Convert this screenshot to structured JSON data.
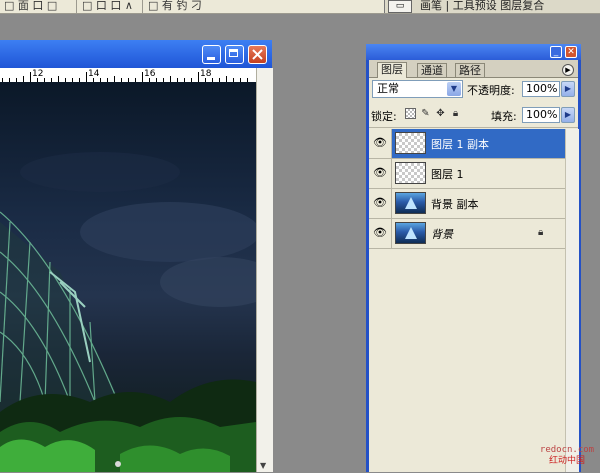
{
  "optionsbar": {
    "fragments": [
      "□ 面 口 □",
      "□ 口 口 ∧",
      "□ 有 钓 刁"
    ],
    "tray_text": "画笔 | 工具预设 图层复合"
  },
  "document": {
    "ruler_labels": [
      "12",
      "14",
      "16",
      "18"
    ]
  },
  "layers_panel": {
    "tabs": [
      {
        "label": "图层",
        "active": true
      },
      {
        "label": "通道",
        "active": false
      },
      {
        "label": "路径",
        "active": false
      }
    ],
    "blend_mode": "正常",
    "opacity_label": "不透明度:",
    "opacity_value": "100%",
    "lock_label": "锁定:",
    "fill_label": "填充:",
    "fill_value": "100%",
    "layers": [
      {
        "name": "图层 1 副本",
        "thumb": "transparent",
        "selected": true,
        "locked": false,
        "visible": true
      },
      {
        "name": "图层 1",
        "thumb": "transparent",
        "selected": false,
        "locked": false,
        "visible": true
      },
      {
        "name": "背景 副本",
        "thumb": "photo",
        "selected": false,
        "locked": false,
        "visible": true
      },
      {
        "name": "背景",
        "thumb": "photo",
        "selected": false,
        "locked": true,
        "visible": true
      }
    ]
  },
  "watermark": {
    "en": "redocn.com",
    "cn": "红动中国"
  },
  "colors": {
    "xp_blue": "#2451c6",
    "selection": "#316ac5",
    "panel_bg": "#ece9d8",
    "workspace": "#8a8a8a"
  }
}
